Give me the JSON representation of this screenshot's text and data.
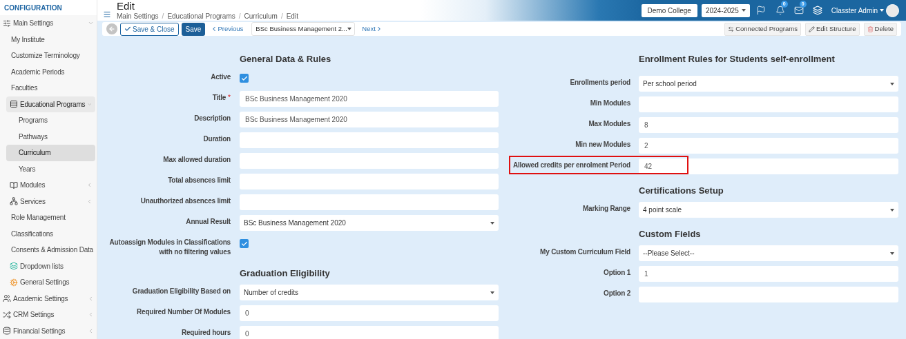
{
  "sidebar": {
    "title": "CONFIGURATION",
    "items": [
      {
        "label": "Main Settings",
        "expanded": true,
        "selected": false,
        "children": [
          {
            "label": "My Institute",
            "selected": false
          },
          {
            "label": "Customize Terminology",
            "selected": false
          },
          {
            "label": "Academic Periods",
            "selected": false
          },
          {
            "label": "Faculties",
            "selected": false
          },
          {
            "label": "Educational Programs",
            "expanded": true,
            "selected": false,
            "children": [
              {
                "label": "Programs",
                "selected": false
              },
              {
                "label": "Pathways",
                "selected": false
              },
              {
                "label": "Curriculum",
                "selected": true
              },
              {
                "label": "Years",
                "selected": false
              }
            ]
          },
          {
            "label": "Modules",
            "expanded": false,
            "selected": false
          },
          {
            "label": "Services",
            "expanded": false,
            "selected": false
          },
          {
            "label": "Role Management",
            "selected": false
          },
          {
            "label": "Classifications",
            "selected": false
          },
          {
            "label": "Consents & Admission Data",
            "selected": false
          },
          {
            "label": "Dropdown lists",
            "selected": false
          },
          {
            "label": "General Settings",
            "selected": false
          }
        ]
      },
      {
        "label": "Academic Settings",
        "expanded": false,
        "selected": false
      },
      {
        "label": "CRM Settings",
        "expanded": false,
        "selected": false
      },
      {
        "label": "Financial Settings",
        "expanded": false,
        "selected": false
      }
    ]
  },
  "header": {
    "title": "Edit",
    "separator": "/",
    "breadcrumbs": [
      "Main Settings",
      "Educational Programs",
      "Curriculum",
      "Edit"
    ],
    "school": "Demo College",
    "year": "2024-2025",
    "notifications": "0",
    "messages": "0",
    "user": "Classter Admin"
  },
  "toolbar": {
    "save_close": "Save & Close",
    "save": "Save",
    "previous": "Previous",
    "record": "BSc Business Management 2...",
    "next": "Next",
    "actions": [
      "Connected Programs",
      "Edit Structure",
      "Delete"
    ]
  },
  "left_column": [
    {
      "title": "General Data & Rules",
      "fields": [
        {
          "label": "Active",
          "kind": "checkbox",
          "checked": true
        },
        {
          "label": "Title",
          "required_mark": "*",
          "kind": "text",
          "value": "BSc Business Management 2020"
        },
        {
          "label": "Description",
          "kind": "text",
          "value": "BSc Business Management 2020"
        },
        {
          "label": "Duration",
          "kind": "text"
        },
        {
          "label": "Max allowed duration",
          "kind": "text"
        },
        {
          "label": "Total absences limit",
          "kind": "text"
        },
        {
          "label": "Unauthorized absences limit",
          "kind": "text"
        },
        {
          "label": "Annual Result",
          "kind": "select",
          "value": "BSc Business Management 2020"
        },
        {
          "label": "Autoassign Modules in Classifications with no filtering values",
          "kind": "checkbox",
          "checked": true
        }
      ]
    },
    {
      "title": "Graduation Eligibility",
      "fields": [
        {
          "label": "Graduation Eligibility Based on",
          "kind": "select",
          "value": "Number of credits"
        },
        {
          "label": "Required Number Of Modules",
          "kind": "text",
          "value": "0"
        },
        {
          "label": "Required hours",
          "kind": "text",
          "value": "0"
        }
      ]
    }
  ],
  "right_column": [
    {
      "title": "Enrollment Rules for Students self-enrollment",
      "fields": [
        {
          "label": "Enrollments period",
          "kind": "select",
          "value": "Per school period",
          "highlighted": false
        },
        {
          "label": "Min Modules",
          "kind": "text",
          "highlighted": false
        },
        {
          "label": "Max Modules",
          "kind": "text",
          "value": "8",
          "highlighted": false
        },
        {
          "label": "Min new Modules",
          "kind": "text",
          "value": "2",
          "highlighted": false
        },
        {
          "label": "Allowed credits per enrolment Period",
          "kind": "text",
          "value": "42",
          "highlighted": true
        }
      ]
    },
    {
      "title": "Certifications Setup",
      "fields": [
        {
          "label": "Marking Range",
          "kind": "select",
          "value": "4 point scale",
          "highlighted": false
        }
      ]
    },
    {
      "title": "Custom Fields",
      "fields": [
        {
          "label": "My Custom Curriculum Field",
          "kind": "select",
          "value": "--Please Select--",
          "highlighted": false
        },
        {
          "label": "Option 1",
          "kind": "text",
          "value": "1",
          "highlighted": false
        },
        {
          "label": "Option 2",
          "kind": "text",
          "highlighted": false
        }
      ]
    }
  ]
}
